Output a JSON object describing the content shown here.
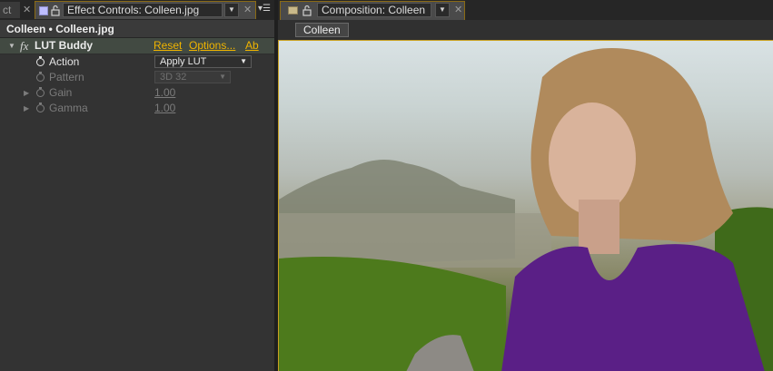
{
  "left_panel": {
    "stub_tab_label": "ct",
    "tab_title": "Effect Controls: Colleen.jpg",
    "subtitle": "Colleen • Colleen.jpg",
    "effect": {
      "name": "LUT Buddy",
      "fx_glyph": "fx",
      "reset_label": "Reset",
      "options_label": "Options...",
      "about_label": "Ab"
    },
    "properties": [
      {
        "name": "Action",
        "value": "Apply LUT",
        "state": "enabled"
      },
      {
        "name": "Pattern",
        "value": "3D 32",
        "state": "disabled"
      },
      {
        "name": "Gain",
        "value": "1.00",
        "state": "disabled"
      },
      {
        "name": "Gamma",
        "value": "1.00",
        "state": "disabled"
      }
    ]
  },
  "right_panel": {
    "tab_title": "Composition: Colleen",
    "breadcrumb": "Colleen",
    "viewer_image": "Colleen.jpg"
  },
  "colors": {
    "active_tab_border": "#c9a020",
    "link": "#f0b400",
    "panel_bg": "#333333",
    "sweater": "#5a1f86"
  },
  "icons": [
    "close-icon",
    "lock-icon",
    "dropdown-arrow-icon",
    "panel-menu-icon",
    "stopwatch-icon",
    "disclosure-triangle-icon",
    "composition-icon"
  ]
}
